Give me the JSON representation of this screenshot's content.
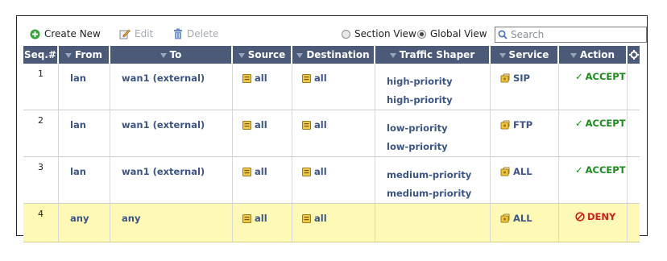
{
  "toolbar": {
    "create_label": "Create New",
    "edit_label": "Edit",
    "delete_label": "Delete",
    "section_view_label": "Section View",
    "global_view_label": "Global View",
    "view_selected": "Global View",
    "search_placeholder": "Search"
  },
  "columns": [
    "Seq.#",
    "From",
    "To",
    "Source",
    "Destination",
    "Traffic Shaper",
    "Service",
    "Action"
  ],
  "rows": [
    {
      "seq": "1",
      "from": "lan",
      "to": "wan1 (external)",
      "source": "all",
      "destination": "all",
      "shaper_1": "high-priority",
      "shaper_2": "high-priority",
      "service": "SIP",
      "action": "ACCEPT"
    },
    {
      "seq": "2",
      "from": "lan",
      "to": "wan1 (external)",
      "source": "all",
      "destination": "all",
      "shaper_1": "low-priority",
      "shaper_2": "low-priority",
      "service": "FTP",
      "action": "ACCEPT"
    },
    {
      "seq": "3",
      "from": "lan",
      "to": "wan1 (external)",
      "source": "all",
      "destination": "all",
      "shaper_1": "medium-priority",
      "shaper_2": "medium-priority",
      "service": "ALL",
      "action": "ACCEPT"
    },
    {
      "seq": "4",
      "from": "any",
      "to": "any",
      "source": "all",
      "destination": "all",
      "shaper_1": "",
      "shaper_2": "",
      "service": "ALL",
      "action": "DENY"
    }
  ],
  "colors": {
    "header_bg": "#4b5a78",
    "link_text": "#3d5585",
    "accept": "#1d8a1d",
    "deny": "#d41a1a",
    "deny_row_bg": "#fef9b4"
  }
}
